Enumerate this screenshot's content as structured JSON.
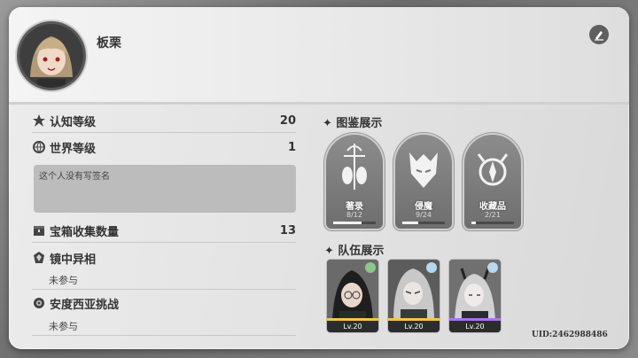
{
  "player": {
    "name": "板栗"
  },
  "stats": {
    "cognition_label": "认知等级",
    "cognition_value": "20",
    "world_label": "世界等级",
    "world_value": "1",
    "signature": "这个人没有写签名",
    "chest_label": "宝箱收集数量",
    "chest_value": "13",
    "mirror_label": "镜中异相",
    "mirror_status": "未参与",
    "andesia_label": "安度西亚挑战",
    "andesia_status": "未参与"
  },
  "codex": {
    "title": "图鉴展示",
    "items": [
      {
        "name": "著录",
        "count": "8/12",
        "progress": 0.67
      },
      {
        "name": "侵魔",
        "count": "9/24",
        "progress": 0.38
      },
      {
        "name": "收藏品",
        "count": "2/21",
        "progress": 0.1
      }
    ]
  },
  "team": {
    "title": "队伍展示",
    "members": [
      {
        "level": "Lv.20",
        "stripe_color": "#f5c542",
        "element": "leaf-icon"
      },
      {
        "level": "Lv.20",
        "stripe_color": "#f5c542",
        "element": "snowflake-icon"
      },
      {
        "level": "Lv.20",
        "stripe_color": "#b070f0",
        "element": "snowflake-icon"
      }
    ]
  },
  "uid": "UID:2462988486"
}
